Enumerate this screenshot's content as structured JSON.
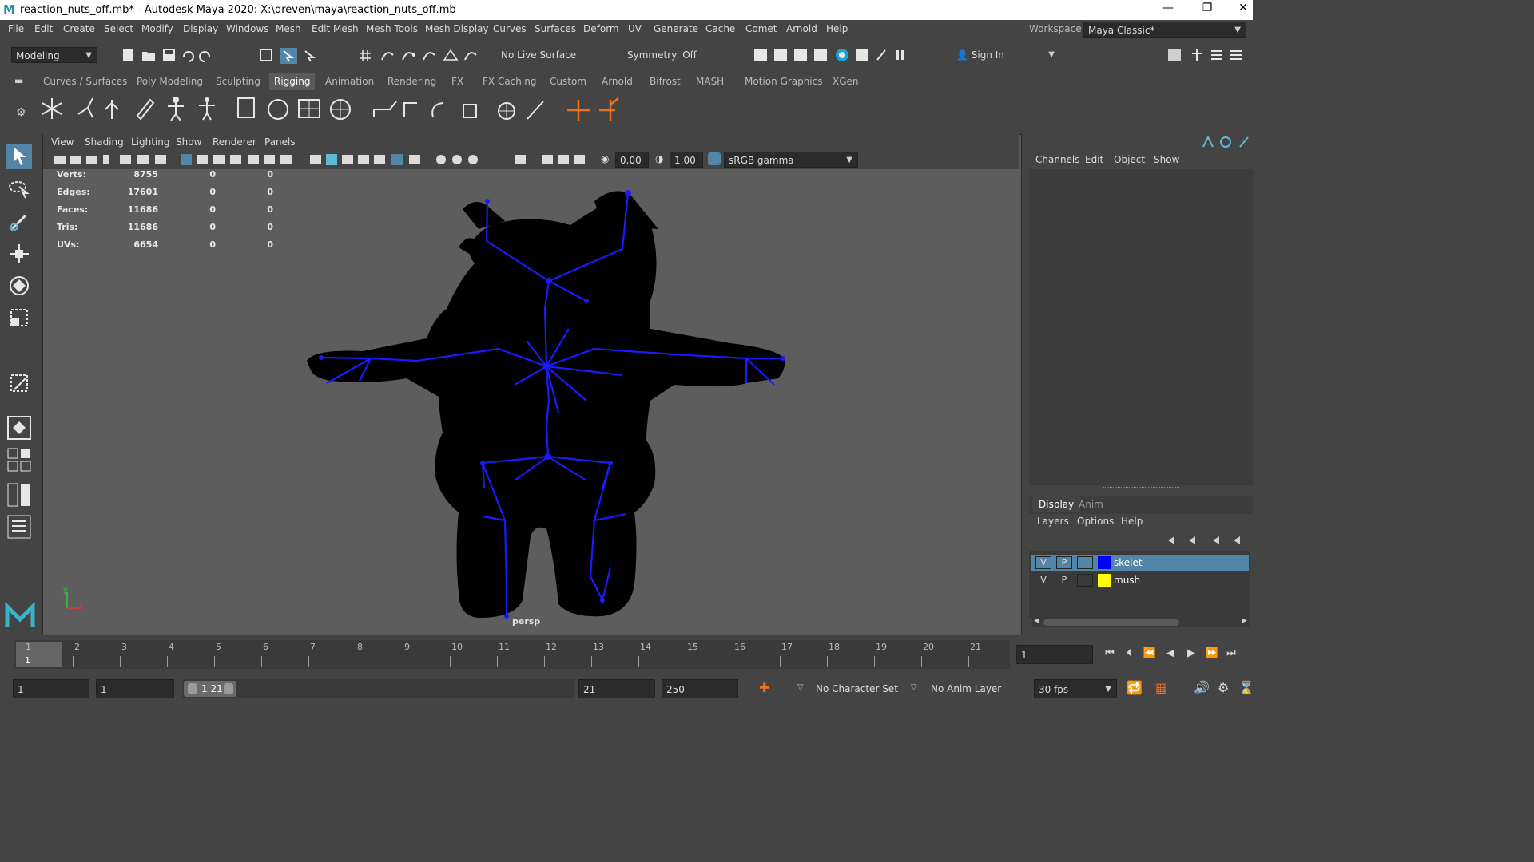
{
  "window": {
    "title": "reaction_nuts_off.mb* - Autodesk Maya 2020: X:\\dreven\\maya\\reaction_nuts_off.mb",
    "logo": "M",
    "minimize": "—",
    "restore": "❐",
    "close": "✕"
  },
  "menus": [
    "File",
    "Edit",
    "Create",
    "Select",
    "Modify",
    "Display",
    "Windows",
    "Mesh",
    "Edit Mesh",
    "Mesh Tools",
    "Mesh Display",
    "Curves",
    "Surfaces",
    "Deform",
    "UV",
    "Generate",
    "Cache",
    "Comet",
    "Arnold",
    "Help"
  ],
  "workspace": {
    "label": "Workspace :",
    "value": "Maya Classic*"
  },
  "statusline": {
    "mode": "Modeling",
    "live_surface": "No Live Surface",
    "symmetry": "Symmetry: Off",
    "sign_in": "Sign In"
  },
  "shelf_tabs": [
    "Curves / Surfaces",
    "Poly Modeling",
    "Sculpting",
    "Rigging",
    "Animation",
    "Rendering",
    "FX",
    "FX Caching",
    "Custom",
    "Arnold",
    "Bifrost",
    "MASH",
    "Motion Graphics",
    "XGen"
  ],
  "active_shelf_tab": "Rigging",
  "viewport": {
    "menus": [
      "View",
      "Shading",
      "Lighting",
      "Show",
      "Renderer",
      "Panels"
    ],
    "exposure": "0.00",
    "gamma": "1.00",
    "color_space": "sRGB gamma",
    "camera_label": "persp",
    "hud": [
      {
        "label": "Verts:",
        "v1": "8755",
        "v2": "0",
        "v3": "0"
      },
      {
        "label": "Edges:",
        "v1": "17601",
        "v2": "0",
        "v3": "0"
      },
      {
        "label": "Faces:",
        "v1": "11686",
        "v2": "0",
        "v3": "0"
      },
      {
        "label": "Tris:",
        "v1": "11686",
        "v2": "0",
        "v3": "0"
      },
      {
        "label": "UVs:",
        "v1": "6654",
        "v2": "0",
        "v3": "0"
      }
    ],
    "axis_y": "y",
    "axis_x": "x"
  },
  "channel_box": {
    "menus": [
      "Channels",
      "Edit",
      "Object",
      "Show"
    ]
  },
  "layer_editor": {
    "tabs": [
      "Display",
      "Anim"
    ],
    "menus": [
      "Layers",
      "Options",
      "Help"
    ],
    "layers": [
      {
        "v": "V",
        "p": "P",
        "name": "skelet",
        "color": "#0000ff",
        "selected": true
      },
      {
        "v": "V",
        "p": "P",
        "name": "mush",
        "color": "#ffff00",
        "selected": false
      }
    ]
  },
  "timeline": {
    "ticks": [
      "1",
      "2",
      "3",
      "4",
      "5",
      "6",
      "7",
      "8",
      "9",
      "10",
      "11",
      "12",
      "13",
      "14",
      "15",
      "16",
      "17",
      "18",
      "19",
      "20",
      "21"
    ],
    "current_frame_marker": "1",
    "current_frame_field": "1"
  },
  "range": {
    "start": "1",
    "playback_start": "1",
    "range_label": "1 21",
    "playback_end": "21",
    "end": "250",
    "character_set": "No Character Set",
    "anim_layer": "No Anim Layer",
    "fps": "30 fps"
  },
  "colors": {
    "skeleton": "#1a1aff",
    "mesh": "#000000",
    "accent": "#5285a6",
    "selected_layer": "#5285a6"
  }
}
